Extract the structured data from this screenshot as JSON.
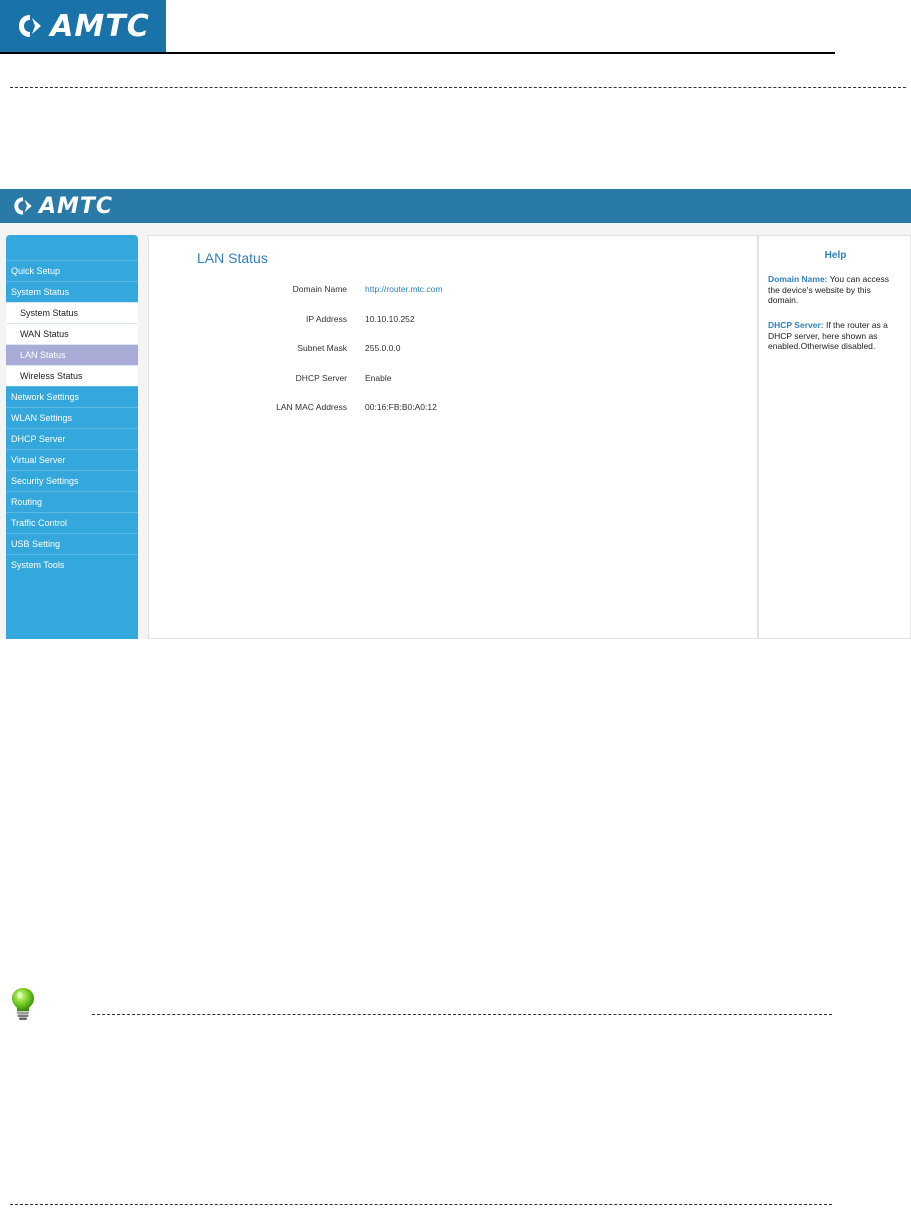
{
  "document": {
    "logo_text": "AMTC"
  },
  "router_ui": {
    "brand": "AMTC",
    "sidebar": {
      "items": [
        {
          "label": "Quick Setup"
        },
        {
          "label": "System Status"
        },
        {
          "label": "System Status",
          "sub": true
        },
        {
          "label": "WAN Status",
          "sub": true
        },
        {
          "label": "LAN Status",
          "sub": true,
          "active": true
        },
        {
          "label": "Wireless Status",
          "sub": true
        },
        {
          "label": "Network Settings"
        },
        {
          "label": "WLAN Settings"
        },
        {
          "label": "DHCP Server"
        },
        {
          "label": "Virtual Server"
        },
        {
          "label": "Security Settings"
        },
        {
          "label": "Routing"
        },
        {
          "label": "Traffic Control"
        },
        {
          "label": "USB Setting"
        },
        {
          "label": "System Tools"
        }
      ]
    },
    "main": {
      "title": "LAN Status",
      "rows": [
        {
          "label": "Domain Name",
          "value": "http://router.mtc.com"
        },
        {
          "label": "IP Address",
          "value": "10.10.10.252"
        },
        {
          "label": "Subnet Mask",
          "value": "255.0.0.0"
        },
        {
          "label": "DHCP Server",
          "value": "Enable"
        },
        {
          "label": "LAN MAC Address",
          "value": "00:16:FB:B0:A0:12"
        }
      ]
    },
    "help": {
      "title": "Help",
      "items": [
        {
          "term": "Domain Name:",
          "text": " You can access the device's website by this domain."
        },
        {
          "term": "DHCP Server:",
          "text": " If the router as a DHCP server, here shown as enabled.Otherwise disabled."
        }
      ]
    }
  },
  "colors": {
    "brand_blue": "#1a73a8",
    "sidebar_blue": "#34a7dd",
    "active_item": "#a9acd6",
    "link_blue": "#2f7fc1"
  },
  "icons": {
    "tip": "lightbulb-icon",
    "logo": "amtc-logo-icon"
  }
}
